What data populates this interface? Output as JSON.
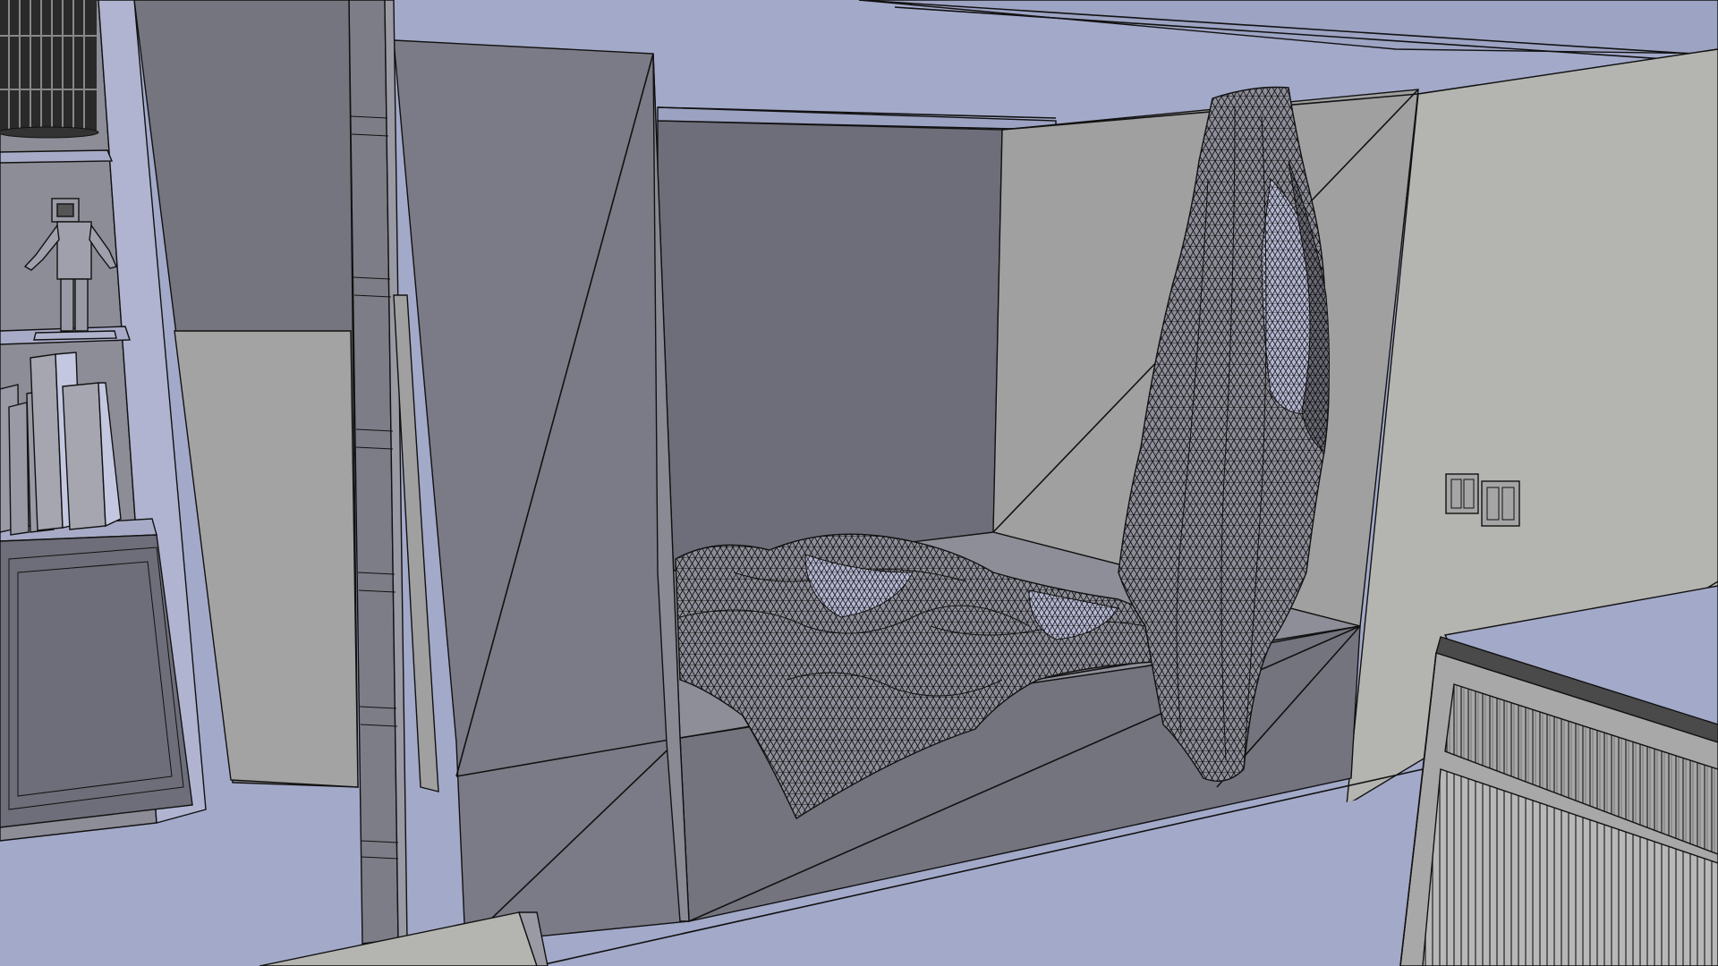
{
  "viewport": {
    "render_mode": "wireframe-on-shaded",
    "colors": {
      "background": "#a3a9c9",
      "floor": "#a3a9c9",
      "wall_dark": "#6e6e7a",
      "wall_mid": "#85858f",
      "wall_light": "#a0a0a0",
      "wall_pale": "#b4b4b0",
      "edge": "#111111",
      "cloth": "#8e8e9a"
    }
  }
}
